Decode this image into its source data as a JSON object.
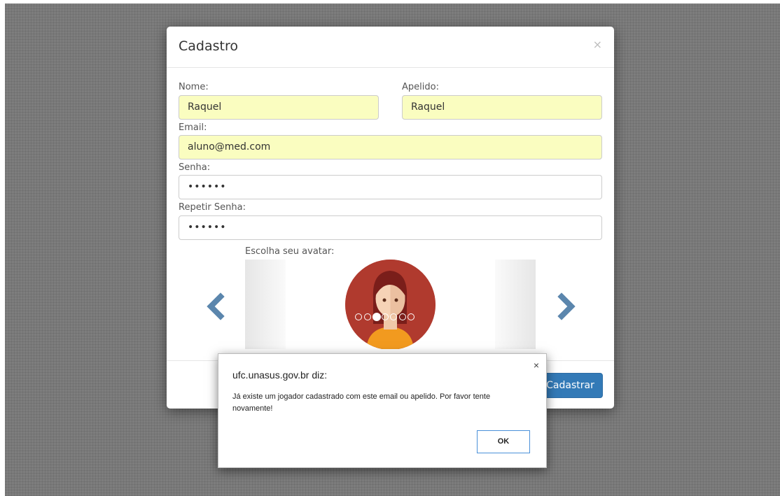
{
  "modal": {
    "title": "Cadastro",
    "close_symbol": "×",
    "nome": {
      "label": "Nome:",
      "value": "Raquel"
    },
    "apelido": {
      "label": "Apelido:",
      "value": "Raquel"
    },
    "email": {
      "label": "Email:",
      "value": "aluno@med.com"
    },
    "senha": {
      "label": "Senha:",
      "value": "••••••"
    },
    "repetir_senha": {
      "label": "Repetir Senha:",
      "value": "••••••"
    },
    "avatar": {
      "label": "Escolha seu avatar:",
      "dot_count": 7,
      "active_dot": 2
    },
    "submit_label": "Cadastrar",
    "icons": [
      "close-icon",
      "chevron-left-icon",
      "chevron-right-icon"
    ]
  },
  "alert": {
    "title": "ufc.unasus.gov.br diz:",
    "close_symbol": "×",
    "message": "Já existe um jogador cadastrado com este email ou apelido. Por favor tente novamente!",
    "ok_label": "OK"
  },
  "colors": {
    "primary": "#337ab7",
    "autofill": "#fafdc0",
    "arrow": "#5b86ad",
    "avatar_bg": "#b03a2e"
  }
}
